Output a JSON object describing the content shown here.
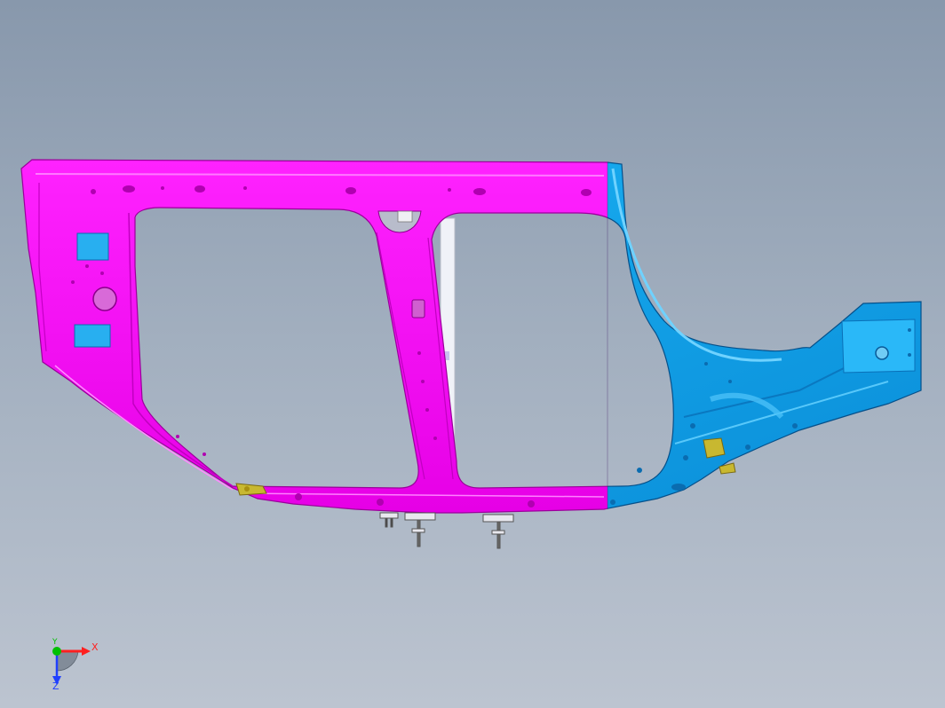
{
  "viewport": {
    "background_top": "#8898ac",
    "background_bottom": "#bcc4d0"
  },
  "model": {
    "part_colors": {
      "inner_panel": "#ff00ff",
      "rear_panel": "#10a8f0",
      "brackets": "#c8b830",
      "pillar_strip": "#f0f2f8"
    }
  },
  "triad": {
    "x_label": "X",
    "y_label": "Y",
    "z_label": "Z",
    "x_color": "#ff2020",
    "y_color": "#00c000",
    "z_color": "#2040ff"
  }
}
